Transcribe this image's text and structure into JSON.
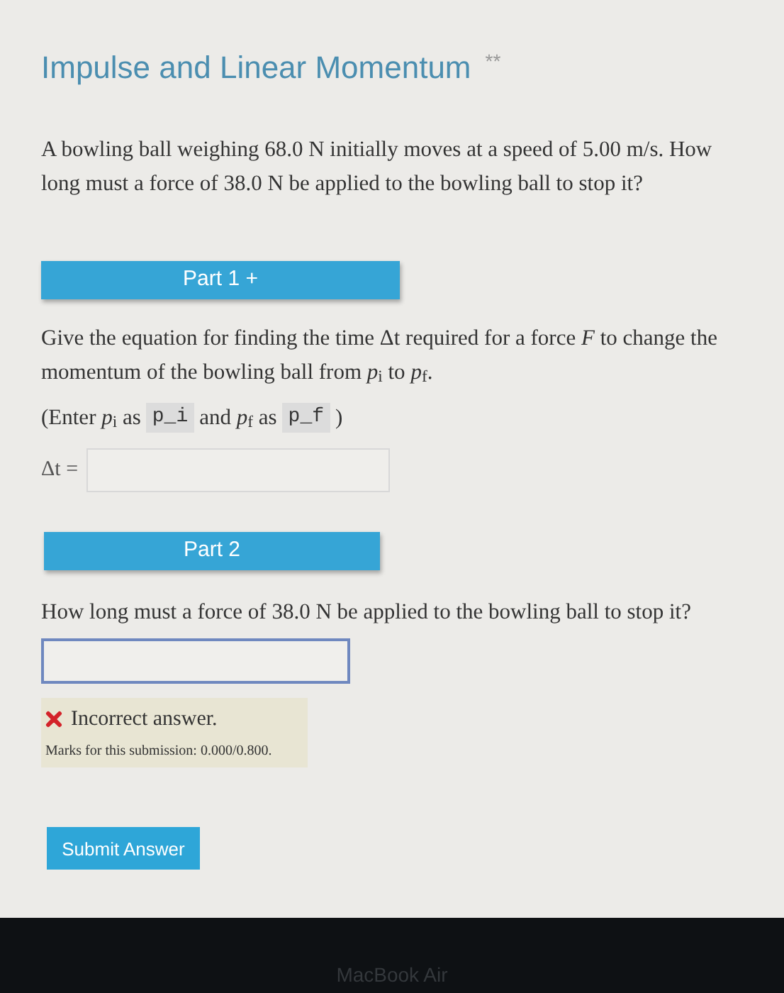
{
  "title": "Impulse and Linear Momentum",
  "title_mark": "**",
  "problem": "A bowling ball weighing 68.0 N initially moves at a speed of 5.00 m/s. How long must a force of 38.0 N be applied to the bowling ball to stop it?",
  "parts": [
    {
      "kind": "equation",
      "header": "Part 1 +",
      "question": "Give the equation for finding the time Δt required for a force *F* to change the momentum of the bowling ball from *p*$_{i}$ to *p*$_{f}$.",
      "hint": [
        {
          "kind": "text",
          "text": "(Enter *p*$_{i}$ as"
        },
        {
          "kind": "code",
          "text": "p_i"
        },
        {
          "kind": "text",
          "text": "and *p*$_{f}$ as"
        },
        {
          "kind": "code",
          "text": "p_f"
        },
        {
          "kind": "text",
          "text": ")"
        }
      ],
      "field_label": "Δt ="
    },
    {
      "kind": "numeric",
      "header": "Part 2",
      "question": "How long must a force of 38.0 N be applied to the bowling ball to stop it?",
      "focused": true,
      "feedback": {
        "kind": "incorrect",
        "message": "Incorrect answer.",
        "marks": "Marks for this submission: 0.000/0.800."
      },
      "submit": "Submit Answer"
    }
  ],
  "bezel": {
    "label": "MacBook Air"
  }
}
